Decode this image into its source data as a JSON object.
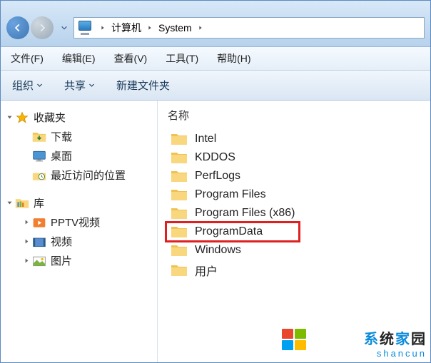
{
  "breadcrumb": {
    "items": [
      "计算机",
      "System"
    ]
  },
  "menubar": {
    "items": [
      "文件(F)",
      "编辑(E)",
      "查看(V)",
      "工具(T)",
      "帮助(H)"
    ]
  },
  "toolbar": {
    "organize": "组织",
    "share": "共享",
    "newfolder": "新建文件夹"
  },
  "sidebar": {
    "favorites": {
      "label": "收藏夹",
      "children": [
        "下载",
        "桌面",
        "最近访问的位置"
      ]
    },
    "libraries": {
      "label": "库",
      "children": [
        "PPTV视频",
        "视频",
        "图片"
      ]
    }
  },
  "main": {
    "column": "名称",
    "highlight_index": 5,
    "items": [
      "Intel",
      "KDDOS",
      "PerfLogs",
      "Program Files",
      "Program Files (x86)",
      "ProgramData",
      "Windows",
      "用户"
    ]
  },
  "watermark": {
    "chars": [
      "系",
      "统",
      "家",
      "园"
    ],
    "sub": "shancun"
  }
}
